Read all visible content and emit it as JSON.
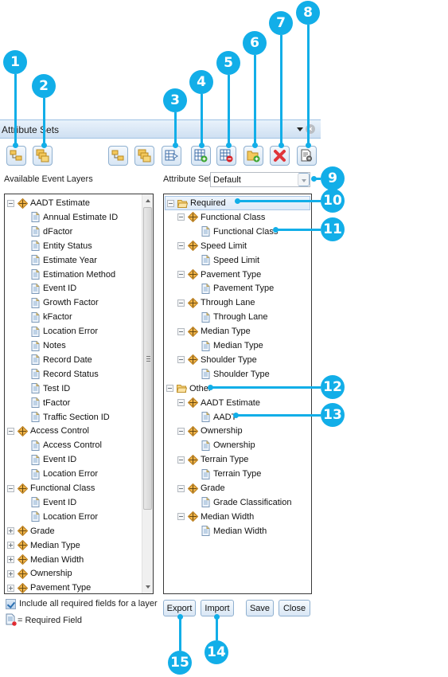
{
  "window": {
    "title": "Attribute Sets",
    "menu_icon": "dropdown-arrow-icon",
    "close_icon": "close-circle-icon"
  },
  "toolbar": {
    "left_buttons": [
      {
        "name": "expand-all-button",
        "icon": "folder-tree-icon"
      },
      {
        "name": "collapse-all-button",
        "icon": "folders-icon"
      }
    ],
    "right_buttons": [
      {
        "name": "expand-all-set-button",
        "icon": "folder-tree-icon"
      },
      {
        "name": "collapse-all-set-button",
        "icon": "folders-icon"
      },
      {
        "name": "add-to-set-button",
        "icon": "table-arrow-icon"
      },
      {
        "name": "new-set-button",
        "icon": "table-add-icon"
      },
      {
        "name": "delete-set-button",
        "icon": "table-remove-icon"
      },
      {
        "name": "new-group-button",
        "icon": "folder-add-icon"
      },
      {
        "name": "remove-item-button",
        "icon": "red-x-icon"
      },
      {
        "name": "properties-button",
        "icon": "document-gear-icon"
      }
    ]
  },
  "left_panel": {
    "heading": "Available Event Layers",
    "tree": [
      {
        "level": 0,
        "type": "layer",
        "toggle": "minus",
        "label": "AADT Estimate"
      },
      {
        "level": 1,
        "type": "field",
        "label": "Annual Estimate ID"
      },
      {
        "level": 1,
        "type": "field",
        "label": "dFactor"
      },
      {
        "level": 1,
        "type": "field",
        "label": "Entity Status"
      },
      {
        "level": 1,
        "type": "field",
        "label": "Estimate Year"
      },
      {
        "level": 1,
        "type": "field",
        "label": "Estimation Method"
      },
      {
        "level": 1,
        "type": "field",
        "label": "Event ID"
      },
      {
        "level": 1,
        "type": "field",
        "label": "Growth Factor"
      },
      {
        "level": 1,
        "type": "field",
        "label": "kFactor"
      },
      {
        "level": 1,
        "type": "field",
        "label": "Location Error"
      },
      {
        "level": 1,
        "type": "field",
        "label": "Notes"
      },
      {
        "level": 1,
        "type": "field",
        "label": "Record Date"
      },
      {
        "level": 1,
        "type": "field",
        "label": "Record Status"
      },
      {
        "level": 1,
        "type": "field",
        "label": "Test ID"
      },
      {
        "level": 1,
        "type": "field",
        "label": "tFactor"
      },
      {
        "level": 1,
        "type": "field",
        "label": "Traffic Section ID"
      },
      {
        "level": 0,
        "type": "layer",
        "toggle": "minus",
        "label": "Access Control"
      },
      {
        "level": 1,
        "type": "field",
        "label": "Access Control"
      },
      {
        "level": 1,
        "type": "field",
        "label": "Event ID"
      },
      {
        "level": 1,
        "type": "field",
        "label": "Location Error"
      },
      {
        "level": 0,
        "type": "layer",
        "toggle": "minus",
        "label": "Functional Class"
      },
      {
        "level": 1,
        "type": "field",
        "label": "Event ID"
      },
      {
        "level": 1,
        "type": "field",
        "label": "Location Error"
      },
      {
        "level": 0,
        "type": "layer",
        "toggle": "plus",
        "label": "Grade"
      },
      {
        "level": 0,
        "type": "layer",
        "toggle": "plus",
        "label": "Median Type"
      },
      {
        "level": 0,
        "type": "layer",
        "toggle": "plus",
        "label": "Median Width"
      },
      {
        "level": 0,
        "type": "layer",
        "toggle": "plus",
        "label": "Ownership"
      },
      {
        "level": 0,
        "type": "layer",
        "toggle": "plus",
        "label": "Pavement Type"
      }
    ],
    "include_required_label": "Include all required fields for a layer",
    "include_required_checked": true,
    "legend_label": "= Required Field"
  },
  "attribute_set": {
    "label": "Attribute Set:",
    "value": "Default"
  },
  "right_panel": {
    "tree": [
      {
        "level": 0,
        "type": "group",
        "toggle": "minus",
        "label": "Required",
        "selected": true
      },
      {
        "level": 1,
        "type": "layer",
        "toggle": "minus",
        "label": "Functional Class"
      },
      {
        "level": 2,
        "type": "field",
        "label": "Functional Class"
      },
      {
        "level": 1,
        "type": "layer",
        "toggle": "minus",
        "label": "Speed Limit"
      },
      {
        "level": 2,
        "type": "field",
        "label": "Speed Limit"
      },
      {
        "level": 1,
        "type": "layer",
        "toggle": "minus",
        "label": "Pavement Type"
      },
      {
        "level": 2,
        "type": "field",
        "label": "Pavement Type"
      },
      {
        "level": 1,
        "type": "layer",
        "toggle": "minus",
        "label": "Through Lane"
      },
      {
        "level": 2,
        "type": "field",
        "label": "Through Lane"
      },
      {
        "level": 1,
        "type": "layer",
        "toggle": "minus",
        "label": "Median Type"
      },
      {
        "level": 2,
        "type": "field",
        "label": "Median Type"
      },
      {
        "level": 1,
        "type": "layer",
        "toggle": "minus",
        "label": "Shoulder Type"
      },
      {
        "level": 2,
        "type": "field",
        "label": "Shoulder Type"
      },
      {
        "level": 0,
        "type": "group",
        "toggle": "minus",
        "label": "Other"
      },
      {
        "level": 1,
        "type": "layer",
        "toggle": "minus",
        "label": "AADT Estimate"
      },
      {
        "level": 2,
        "type": "field",
        "label": "AADT"
      },
      {
        "level": 1,
        "type": "layer",
        "toggle": "minus",
        "label": "Ownership"
      },
      {
        "level": 2,
        "type": "field",
        "label": "Ownership"
      },
      {
        "level": 1,
        "type": "layer",
        "toggle": "minus",
        "label": "Terrain Type"
      },
      {
        "level": 2,
        "type": "field",
        "label": "Terrain Type"
      },
      {
        "level": 1,
        "type": "layer",
        "toggle": "minus",
        "label": "Grade"
      },
      {
        "level": 2,
        "type": "field",
        "label": "Grade Classification"
      },
      {
        "level": 1,
        "type": "layer",
        "toggle": "minus",
        "label": "Median Width"
      },
      {
        "level": 2,
        "type": "field",
        "label": "Median Width"
      }
    ]
  },
  "buttons": {
    "export": "Export",
    "import": "Import",
    "save": "Save",
    "close": "Close"
  },
  "callouts": [
    "1",
    "2",
    "3",
    "4",
    "5",
    "6",
    "7",
    "8",
    "9",
    "10",
    "11",
    "12",
    "13",
    "14",
    "15"
  ],
  "colors": {
    "callout": "#12aee8",
    "titlebar": "#d9e7f5",
    "selection": "#dde9f7"
  }
}
